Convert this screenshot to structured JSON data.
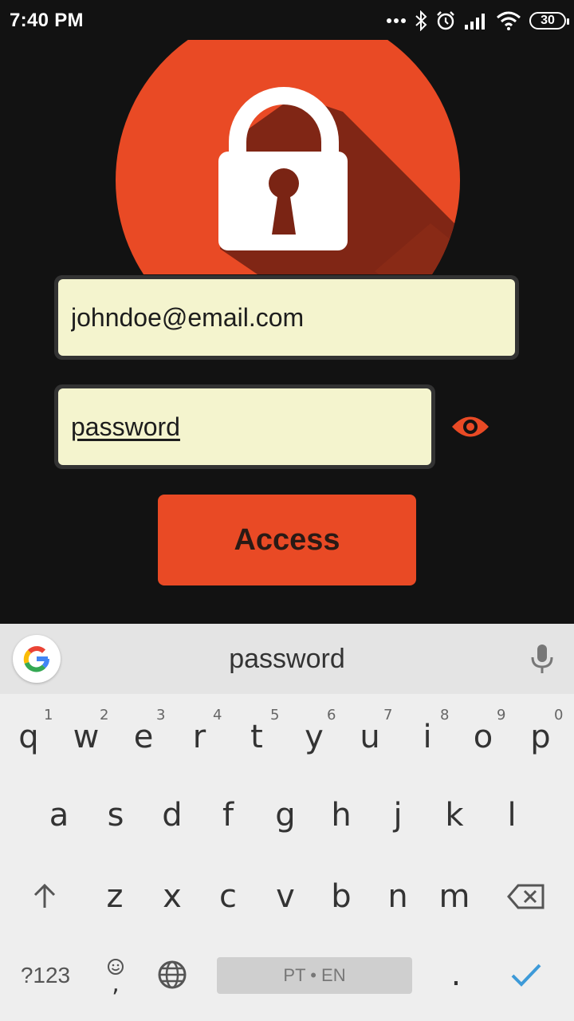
{
  "status_bar": {
    "time": "7:40 PM",
    "battery": "30"
  },
  "login": {
    "email_value": "johndoe@email.com",
    "password_value": "password",
    "access_label": "Access"
  },
  "keyboard": {
    "suggestion": "password",
    "row1": [
      "q",
      "w",
      "e",
      "r",
      "t",
      "y",
      "u",
      "i",
      "o",
      "p"
    ],
    "row1_hints": [
      "1",
      "2",
      "3",
      "4",
      "5",
      "6",
      "7",
      "8",
      "9",
      "0"
    ],
    "row2": [
      "a",
      "s",
      "d",
      "f",
      "g",
      "h",
      "j",
      "k",
      "l"
    ],
    "row3": [
      "z",
      "x",
      "c",
      "v",
      "b",
      "n",
      "m"
    ],
    "symbols_label": "?123",
    "comma_label": ",",
    "period_label": ".",
    "space_label": "PT • EN"
  },
  "colors": {
    "accent": "#e94a25",
    "field_bg": "#f4f4ce",
    "background": "#121212"
  }
}
